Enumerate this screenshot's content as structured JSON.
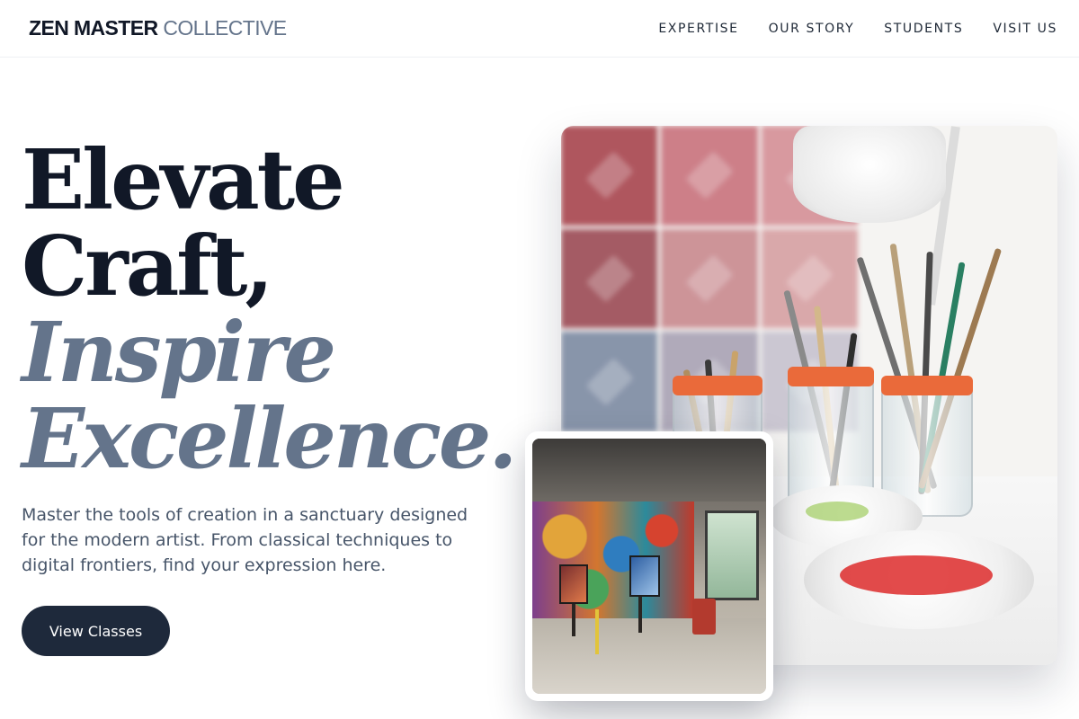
{
  "brand": {
    "strong": "ZEN MASTER",
    "light": "COLLECTIVE"
  },
  "nav": [
    "EXPERTISE",
    "OUR STORY",
    "STUDENTS",
    "VISIT US"
  ],
  "hero": {
    "line1": "Elevate",
    "line2": "Craft,",
    "line3": "Inspire",
    "line4": "Excellence.",
    "description": "Master the tools of creation in a sanctuary designed for the modern artist. From classical techniques to digital frontiers, find your expression here.",
    "cta_label": "View Classes"
  },
  "colors": {
    "heading_dark": "#111827",
    "heading_muted": "#64748b",
    "cta_background": "#1e293b",
    "text_body": "#475569"
  }
}
